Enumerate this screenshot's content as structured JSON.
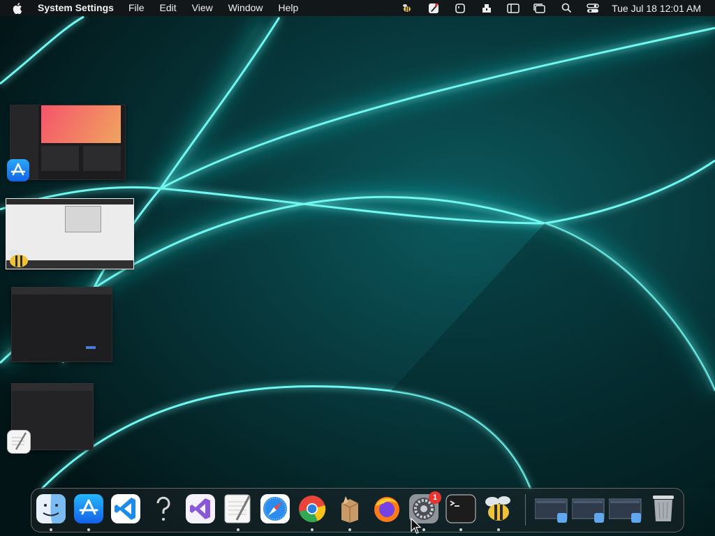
{
  "menubar": {
    "app_name": "System Settings",
    "menus": [
      "File",
      "Edit",
      "View",
      "Window",
      "Help"
    ],
    "clock": "Tue Jul 18  12:01 AM",
    "status_icons": [
      "bee-icon",
      "pen-icon",
      "screen-capture-icon",
      "package-icon",
      "sidebar-icon",
      "window-icon",
      "search-icon",
      "control-center-icon"
    ]
  },
  "window_thumbnails": [
    {
      "app": "App Store",
      "icon": "app-store-icon"
    },
    {
      "app": "BeeCLI",
      "icon": "bee-icon"
    },
    {
      "app": "Terminal-like dialog",
      "icon": "none"
    },
    {
      "app": "TextEdit",
      "icon": "textedit-icon"
    }
  ],
  "dock": {
    "items": [
      {
        "name": "Finder",
        "icon": "finder-icon",
        "running": true
      },
      {
        "name": "App Store",
        "icon": "app-store-icon",
        "running": true
      },
      {
        "name": "Visual Studio Code",
        "icon": "vscode-icon",
        "running": false
      },
      {
        "name": "Help",
        "icon": "question-icon",
        "running": false
      },
      {
        "name": "Visual Studio",
        "icon": "visual-studio-icon",
        "running": false
      },
      {
        "name": "TextEdit",
        "icon": "textedit-icon",
        "running": true
      },
      {
        "name": "Safari",
        "icon": "safari-icon",
        "running": false
      },
      {
        "name": "Chrome",
        "icon": "chrome-icon",
        "running": true
      },
      {
        "name": "Installer",
        "icon": "package-icon",
        "running": true
      },
      {
        "name": "Firefox",
        "icon": "firefox-icon",
        "running": false
      },
      {
        "name": "System Settings",
        "icon": "gear-icon",
        "running": true,
        "badge": "1"
      },
      {
        "name": "Terminal",
        "icon": "terminal-icon",
        "running": true
      },
      {
        "name": "Bee",
        "icon": "bee-icon",
        "running": true
      }
    ],
    "minimized": [
      {
        "name": "Finder window 1",
        "icon": "finder-window-icon"
      },
      {
        "name": "Finder window 2",
        "icon": "finder-window-icon"
      },
      {
        "name": "Finder window 3",
        "icon": "finder-window-icon"
      }
    ],
    "trash": {
      "name": "Trash",
      "icon": "trash-icon"
    }
  },
  "colors": {
    "wallpaper_dark": "#02161a",
    "wallpaper_glow": "#3fe7e0",
    "menubar_bg": "#141618",
    "badge": "#e8352f"
  }
}
